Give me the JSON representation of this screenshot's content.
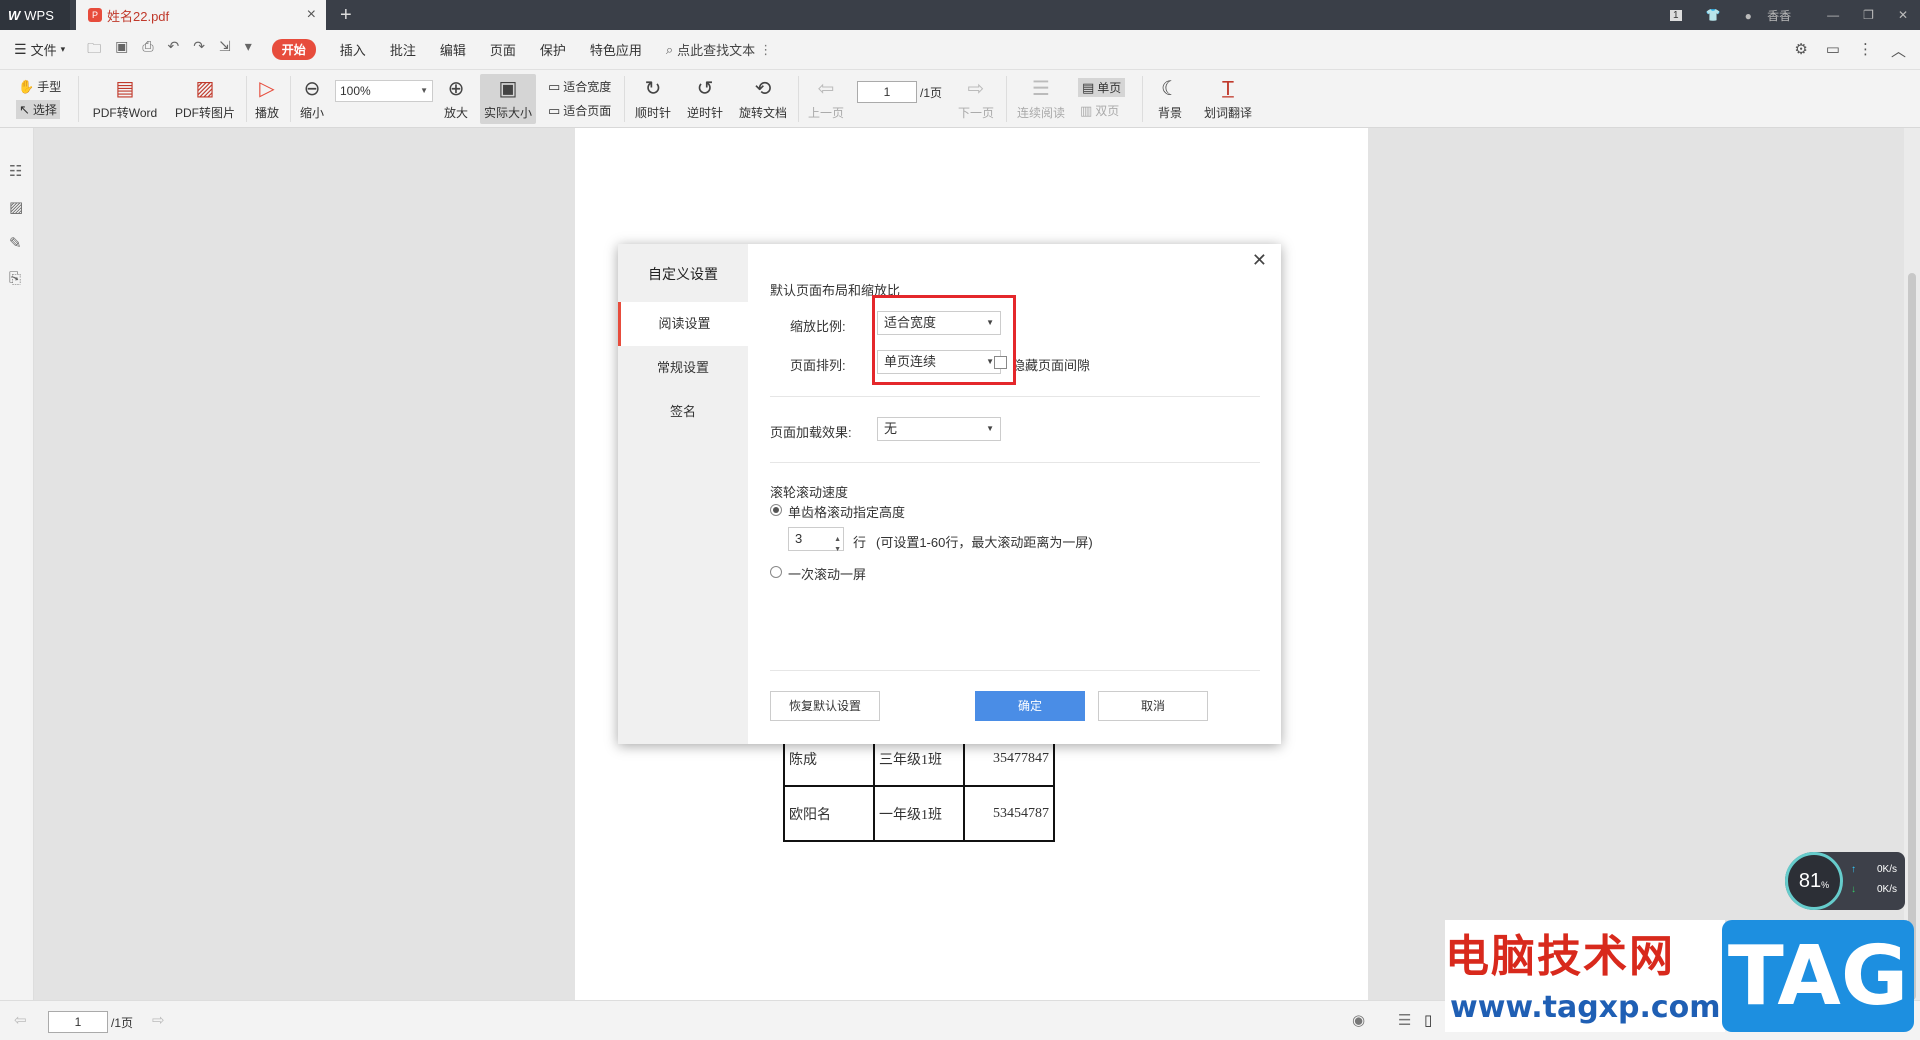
{
  "titlebar": {
    "app_name": "WPS",
    "doc_tab": "姓名22.pdf",
    "new_tab_icon": "plus",
    "user_name": "香香",
    "badge": "1"
  },
  "menubar": {
    "file": "文件",
    "start": "开始",
    "items": [
      "插入",
      "批注",
      "编辑",
      "页面",
      "保护",
      "特色应用"
    ],
    "search": "点此查找文本"
  },
  "toolbar": {
    "hand": "手型",
    "select": "选择",
    "pdf_to_word": "PDF转Word",
    "pdf_to_image": "PDF转图片",
    "play": "播放",
    "zoom_out": "缩小",
    "zoom_value": "100%",
    "zoom_in": "放大",
    "actual_size": "实际大小",
    "fit_width": "适合宽度",
    "fit_page": "适合页面",
    "clockwise": "顺时针",
    "counter_clockwise": "逆时针",
    "rotate_doc": "旋转文档",
    "prev_page": "上一页",
    "page_value": "1",
    "page_total": "/1页",
    "next_page": "下一页",
    "continuous": "连续阅读",
    "single_page": "单页",
    "double_page": "双页",
    "background": "背景",
    "translate": "划词翻译"
  },
  "document": {
    "rows": [
      {
        "name": "陈成",
        "class": "三年级1班",
        "number": "35477847"
      },
      {
        "name": "欧阳名",
        "class": "一年级1班",
        "number": "53454787"
      }
    ]
  },
  "dialog": {
    "title": "自定义设置",
    "nav": [
      "阅读设置",
      "常规设置",
      "签名"
    ],
    "section_layout": "默认页面布局和缩放比",
    "zoom_label": "缩放比例:",
    "zoom_value": "适合宽度",
    "arrange_label": "页面排列:",
    "arrange_value": "单页连续",
    "hide_gap": "隐藏页面间隙",
    "load_label": "页面加载效果:",
    "load_value": "无",
    "scroll_title": "滚轮滚动速度",
    "radio_step": "单齿格滚动指定高度",
    "step_value": "3",
    "step_unit": "行",
    "step_hint": "(可设置1-60行，最大滚动距离为一屏)",
    "radio_screen": "一次滚动一屏",
    "restore": "恢复默认设置",
    "ok": "确定",
    "cancel": "取消"
  },
  "statusbar": {
    "page_value": "1",
    "page_total": "/1页"
  },
  "network": {
    "percent": "81",
    "unit": "%",
    "up": "0K/s",
    "down": "0K/s"
  },
  "watermark": {
    "text": "电脑技术网",
    "url": "www.tagxp.com",
    "tag": "TAG"
  }
}
